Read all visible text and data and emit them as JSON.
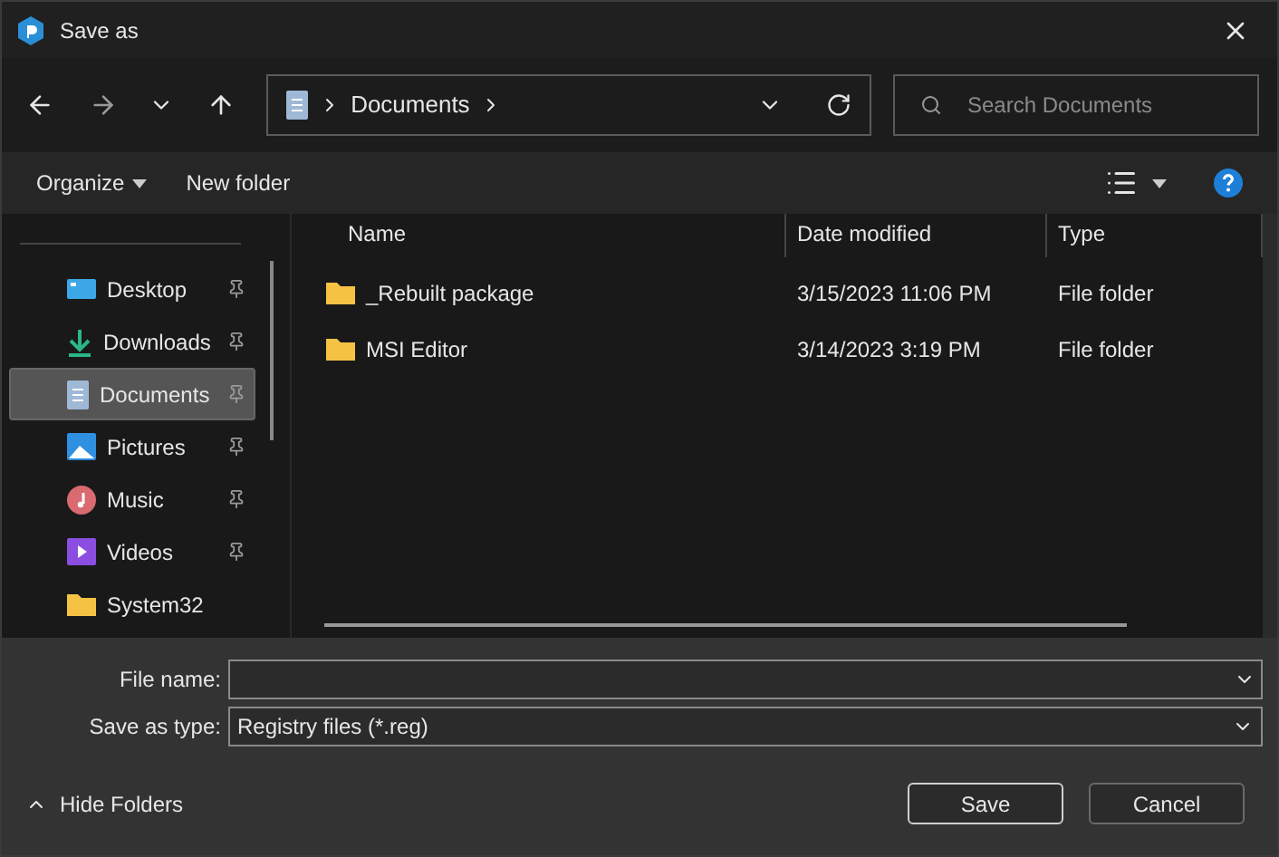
{
  "window": {
    "title": "Save as"
  },
  "address": {
    "crumbs": [
      "Documents"
    ]
  },
  "search": {
    "placeholder": "Search Documents"
  },
  "toolbar": {
    "organize": "Organize",
    "new_folder": "New folder"
  },
  "sidebar": {
    "items": [
      {
        "label": "Desktop",
        "kind": "desktop",
        "pinned": true,
        "selected": false
      },
      {
        "label": "Downloads",
        "kind": "downloads",
        "pinned": true,
        "selected": false
      },
      {
        "label": "Documents",
        "kind": "documents",
        "pinned": true,
        "selected": true
      },
      {
        "label": "Pictures",
        "kind": "pictures",
        "pinned": true,
        "selected": false
      },
      {
        "label": "Music",
        "kind": "music",
        "pinned": true,
        "selected": false
      },
      {
        "label": "Videos",
        "kind": "videos",
        "pinned": true,
        "selected": false
      },
      {
        "label": "System32",
        "kind": "folder",
        "pinned": false,
        "selected": false
      }
    ]
  },
  "table": {
    "columns": [
      "Name",
      "Date modified",
      "Type"
    ],
    "rows": [
      {
        "name": "_Rebuilt package",
        "date": "3/15/2023 11:06 PM",
        "type": "File folder"
      },
      {
        "name": "MSI Editor",
        "date": "3/14/2023 3:19 PM",
        "type": "File folder"
      }
    ]
  },
  "form": {
    "file_name_label": "File name:",
    "type_label": "Save as type:",
    "type_value": "Registry files (*.reg)"
  },
  "footer": {
    "hide_folders": "Hide Folders",
    "buttons": [
      "Save",
      "Cancel"
    ]
  }
}
